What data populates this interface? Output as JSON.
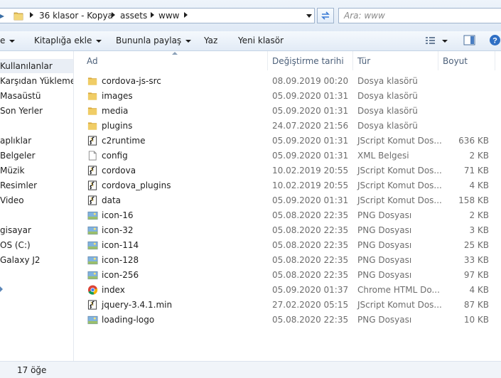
{
  "address": {
    "crumbs": [
      "36 klasor - Kopya",
      "assets",
      "www"
    ],
    "search_placeholder": "Ara: www"
  },
  "toolbar": {
    "items": [
      "e",
      "Kitaplığa ekle",
      "Bununla paylaş",
      "Yaz",
      "Yeni klasör"
    ]
  },
  "nav": {
    "items": [
      "Kullanılanlar",
      "Karşıdan Yüklemeler",
      "Masaüstü",
      "Son Yerler",
      "aplıklar",
      "Belgeler",
      "Müzik",
      "Resimler",
      "Video",
      "gisayar",
      "OS (C:)",
      "Galaxy J2"
    ]
  },
  "columns": {
    "name": "Ad",
    "date": "Değiştirme tarihi",
    "type": "Tür",
    "size": "Boyut"
  },
  "files": [
    {
      "name": "cordova-js-src",
      "date": "08.09.2019 00:20",
      "type": "Dosya klasörü",
      "size": "",
      "icon": "folder-icon"
    },
    {
      "name": "images",
      "date": "05.09.2020 01:31",
      "type": "Dosya klasörü",
      "size": "",
      "icon": "folder-icon"
    },
    {
      "name": "media",
      "date": "05.09.2020 01:31",
      "type": "Dosya klasörü",
      "size": "",
      "icon": "folder-icon"
    },
    {
      "name": "plugins",
      "date": "24.07.2020 21:56",
      "type": "Dosya klasörü",
      "size": "",
      "icon": "folder-icon"
    },
    {
      "name": "c2runtime",
      "date": "05.09.2020 01:31",
      "type": "JScript Komut Dos...",
      "size": "636 KB",
      "icon": "script-icon"
    },
    {
      "name": "config",
      "date": "05.09.2020 01:31",
      "type": "XML Belgesi",
      "size": "2 KB",
      "icon": "document-icon"
    },
    {
      "name": "cordova",
      "date": "10.02.2019 20:55",
      "type": "JScript Komut Dos...",
      "size": "71 KB",
      "icon": "script-icon"
    },
    {
      "name": "cordova_plugins",
      "date": "10.02.2019 20:55",
      "type": "JScript Komut Dos...",
      "size": "4 KB",
      "icon": "script-icon"
    },
    {
      "name": "data",
      "date": "05.09.2020 01:31",
      "type": "JScript Komut Dos...",
      "size": "158 KB",
      "icon": "script-icon"
    },
    {
      "name": "icon-16",
      "date": "05.08.2020 22:35",
      "type": "PNG Dosyası",
      "size": "2 KB",
      "icon": "image-icon"
    },
    {
      "name": "icon-32",
      "date": "05.08.2020 22:35",
      "type": "PNG Dosyası",
      "size": "3 KB",
      "icon": "image-icon"
    },
    {
      "name": "icon-114",
      "date": "05.08.2020 22:35",
      "type": "PNG Dosyası",
      "size": "25 KB",
      "icon": "image-icon"
    },
    {
      "name": "icon-128",
      "date": "05.08.2020 22:35",
      "type": "PNG Dosyası",
      "size": "33 KB",
      "icon": "image-icon"
    },
    {
      "name": "icon-256",
      "date": "05.08.2020 22:35",
      "type": "PNG Dosyası",
      "size": "97 KB",
      "icon": "image-icon"
    },
    {
      "name": "index",
      "date": "05.09.2020 01:37",
      "type": "Chrome HTML Do...",
      "size": "4 KB",
      "icon": "chrome-icon"
    },
    {
      "name": "jquery-3.4.1.min",
      "date": "27.02.2020 05:15",
      "type": "JScript Komut Dos...",
      "size": "87 KB",
      "icon": "script-icon"
    },
    {
      "name": "loading-logo",
      "date": "05.08.2020 22:35",
      "type": "PNG Dosyası",
      "size": "10 KB",
      "icon": "image-icon"
    }
  ],
  "status": {
    "text": "17 öğe"
  }
}
